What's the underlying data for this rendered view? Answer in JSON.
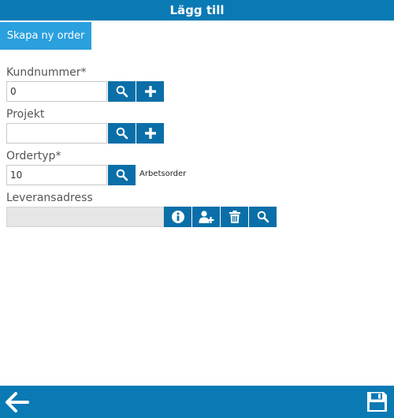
{
  "header": {
    "title": "Lägg till"
  },
  "actions": {
    "create_order_label": "Skapa ny order"
  },
  "form": {
    "customer_number": {
      "label": "Kundnummer*",
      "value": "0"
    },
    "project": {
      "label": "Projekt",
      "value": ""
    },
    "order_type": {
      "label": "Ordertyp*",
      "value": "10",
      "description": "Arbetsorder"
    },
    "delivery_address": {
      "label": "Leveransadress",
      "value": ""
    }
  },
  "icons": {
    "search": "search-icon",
    "add": "plus-icon",
    "info": "info-icon",
    "add_person": "add-person-icon",
    "delete": "trash-icon",
    "back": "arrow-left-icon",
    "save": "floppy-disk-icon"
  },
  "colors": {
    "header": "#0a7ab5",
    "button": "#0a6fa8",
    "create_button": "#2aa0de"
  }
}
